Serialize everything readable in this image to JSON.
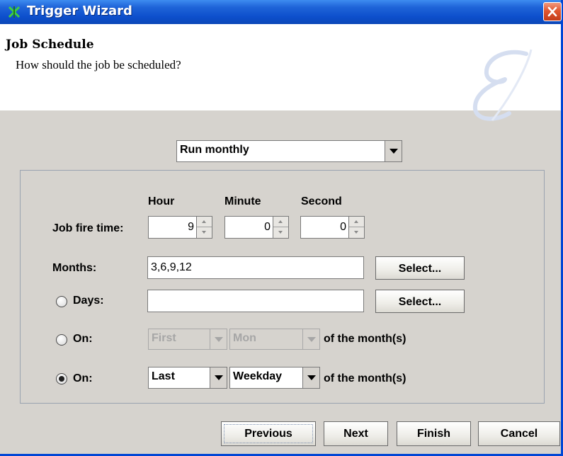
{
  "window": {
    "title": "Trigger Wizard"
  },
  "header": {
    "title": "Job Schedule",
    "subtitle": "How should the job be scheduled?"
  },
  "schedule_type": {
    "selected": "Run monthly"
  },
  "time": {
    "label": "Job fire time:",
    "hour_header": "Hour",
    "minute_header": "Minute",
    "second_header": "Second",
    "hour": "9",
    "minute": "0",
    "second": "0"
  },
  "months": {
    "label": "Months:",
    "value": "3,6,9,12",
    "select_label": "Select..."
  },
  "days": {
    "label": "Days:",
    "value": "",
    "select_label": "Select...",
    "selected": false
  },
  "on_first": {
    "label": "On:",
    "ordinal": "First",
    "day": "Mon",
    "suffix": "of the month(s)",
    "selected": false,
    "enabled": false
  },
  "on_last": {
    "label": "On:",
    "ordinal": "Last",
    "day": "Weekday",
    "suffix": "of the month(s)",
    "selected": true,
    "enabled": true
  },
  "footer": {
    "previous_label": "Previous",
    "next_label": "Next",
    "finish_label": "Finish",
    "cancel_label": "Cancel"
  }
}
